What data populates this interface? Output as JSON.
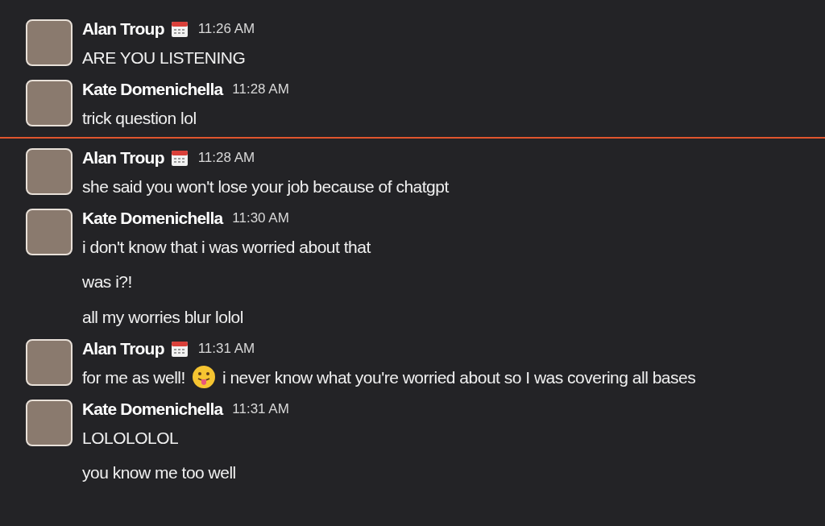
{
  "messages": [
    {
      "kind": "message",
      "author": "Alan Troup",
      "status_emoji": true,
      "time": "11:26 AM",
      "lines": [
        [
          {
            "kind": "text",
            "text": "ARE YOU LISTENING"
          }
        ]
      ]
    },
    {
      "kind": "message",
      "author": "Kate Domenichella",
      "status_emoji": false,
      "time": "11:28 AM",
      "lines": [
        [
          {
            "kind": "text",
            "text": "trick question lol"
          }
        ]
      ]
    },
    {
      "kind": "divider"
    },
    {
      "kind": "message",
      "author": "Alan Troup",
      "status_emoji": true,
      "time": "11:28 AM",
      "lines": [
        [
          {
            "kind": "text",
            "text": "she said you won't lose your job because of chatgpt"
          }
        ]
      ]
    },
    {
      "kind": "message",
      "author": "Kate Domenichella",
      "status_emoji": false,
      "time": "11:30 AM",
      "lines": [
        [
          {
            "kind": "text",
            "text": "i don't know that i was worried about that"
          }
        ],
        [
          {
            "kind": "text",
            "text": "was i?!"
          }
        ],
        [
          {
            "kind": "text",
            "text": "all my worries blur lolol"
          }
        ]
      ]
    },
    {
      "kind": "message",
      "author": "Alan Troup",
      "status_emoji": true,
      "time": "11:31 AM",
      "lines": [
        [
          {
            "kind": "text",
            "text": "for me as well!"
          },
          {
            "kind": "emoji"
          },
          {
            "kind": "text",
            "text": "i never know what you're worried about so I was covering all bases"
          }
        ]
      ]
    },
    {
      "kind": "message",
      "author": "Kate Domenichella",
      "status_emoji": false,
      "time": "11:31 AM",
      "lines": [
        [
          {
            "kind": "text",
            "text": "LOLOLOLOL"
          }
        ],
        [
          {
            "kind": "text",
            "text": "you know me too well"
          }
        ]
      ]
    }
  ]
}
